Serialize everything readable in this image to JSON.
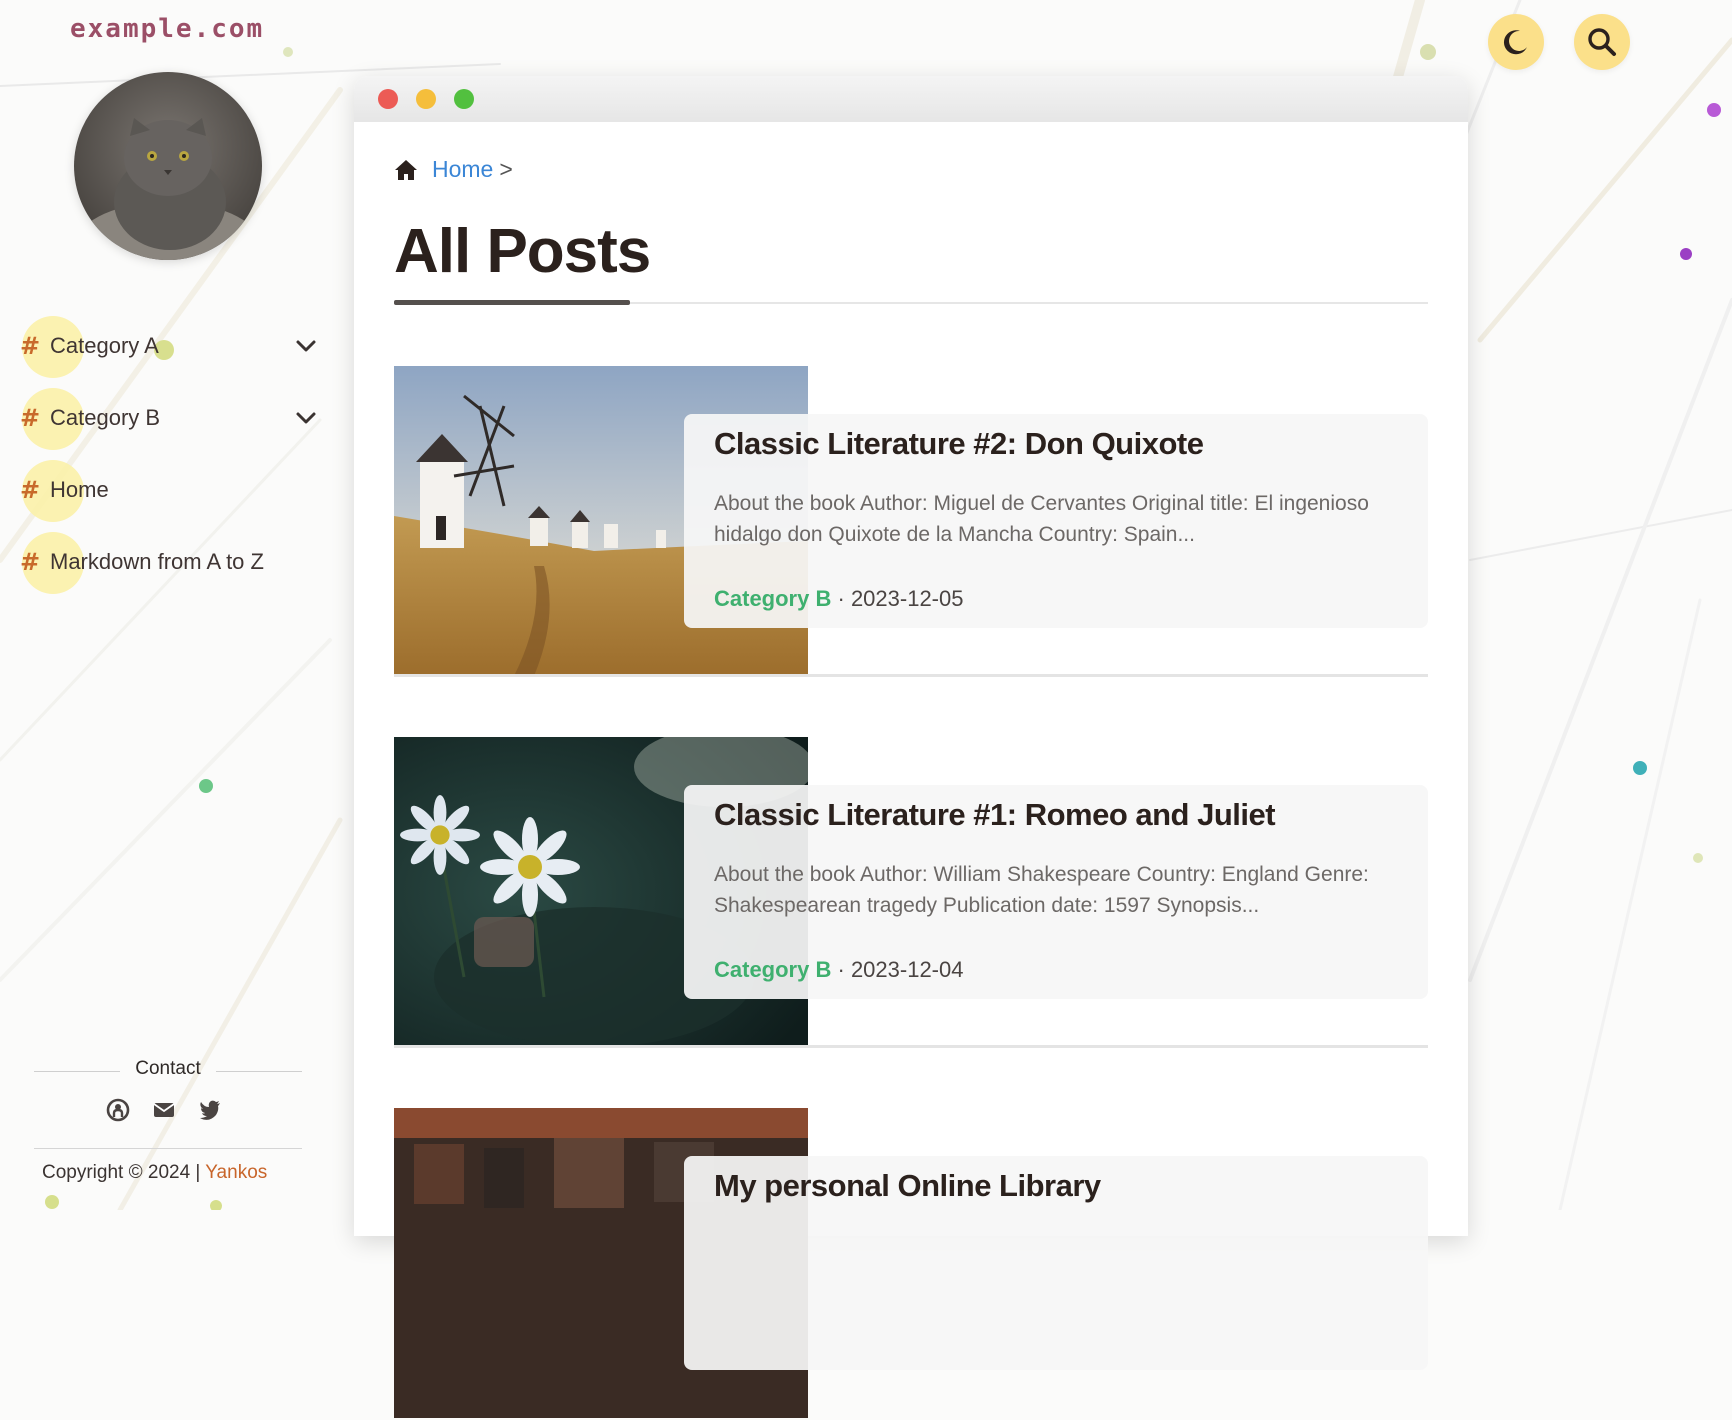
{
  "site": {
    "name": "example.com"
  },
  "sidebar": {
    "items": [
      {
        "label": "Category A",
        "has_children": true
      },
      {
        "label": "Category B",
        "has_children": true
      },
      {
        "label": "Home",
        "has_children": false
      },
      {
        "label": "Markdown from A to Z",
        "has_children": false
      }
    ],
    "hash_symbol": "#",
    "contact_label": "Contact",
    "social_icons": [
      "github-icon",
      "email-icon",
      "twitter-icon"
    ],
    "copyright_text": "Copyright © 2024 |",
    "copyright_author": "Yankos"
  },
  "toolbar": {
    "dark_mode_icon": "moon-icon",
    "search_icon": "search-icon"
  },
  "main": {
    "breadcrumb": {
      "home_label": "Home",
      "separator": ">"
    },
    "page_title": "All Posts",
    "posts": [
      {
        "title": "Classic Literature #2: Don Quixote",
        "excerpt": "About the book Author: Miguel de Cervantes Original title: El ingenioso hidalgo don Quixote de la Mancha Country: Spain...",
        "category": "Category B",
        "separator": "·",
        "date": "2023-12-05"
      },
      {
        "title": "Classic Literature #1: Romeo and Juliet",
        "excerpt": "About the book Author: William Shakespeare Country: England Genre: Shakespearean tragedy Publication date: 1597 Synopsis...",
        "category": "Category B",
        "separator": "·",
        "date": "2023-12-04"
      },
      {
        "title": "My personal Online Library",
        "excerpt": "",
        "category": "",
        "separator": "",
        "date": ""
      }
    ]
  },
  "colors": {
    "accent_yellow": "#fbe08a",
    "link_blue": "#3b86d6",
    "category_green": "#3fb06f",
    "hash_orange": "#c86a2b",
    "site_name": "#9b4f67",
    "close": "#ec5b55",
    "minimize": "#f5be3b",
    "maximize": "#52c03f"
  }
}
